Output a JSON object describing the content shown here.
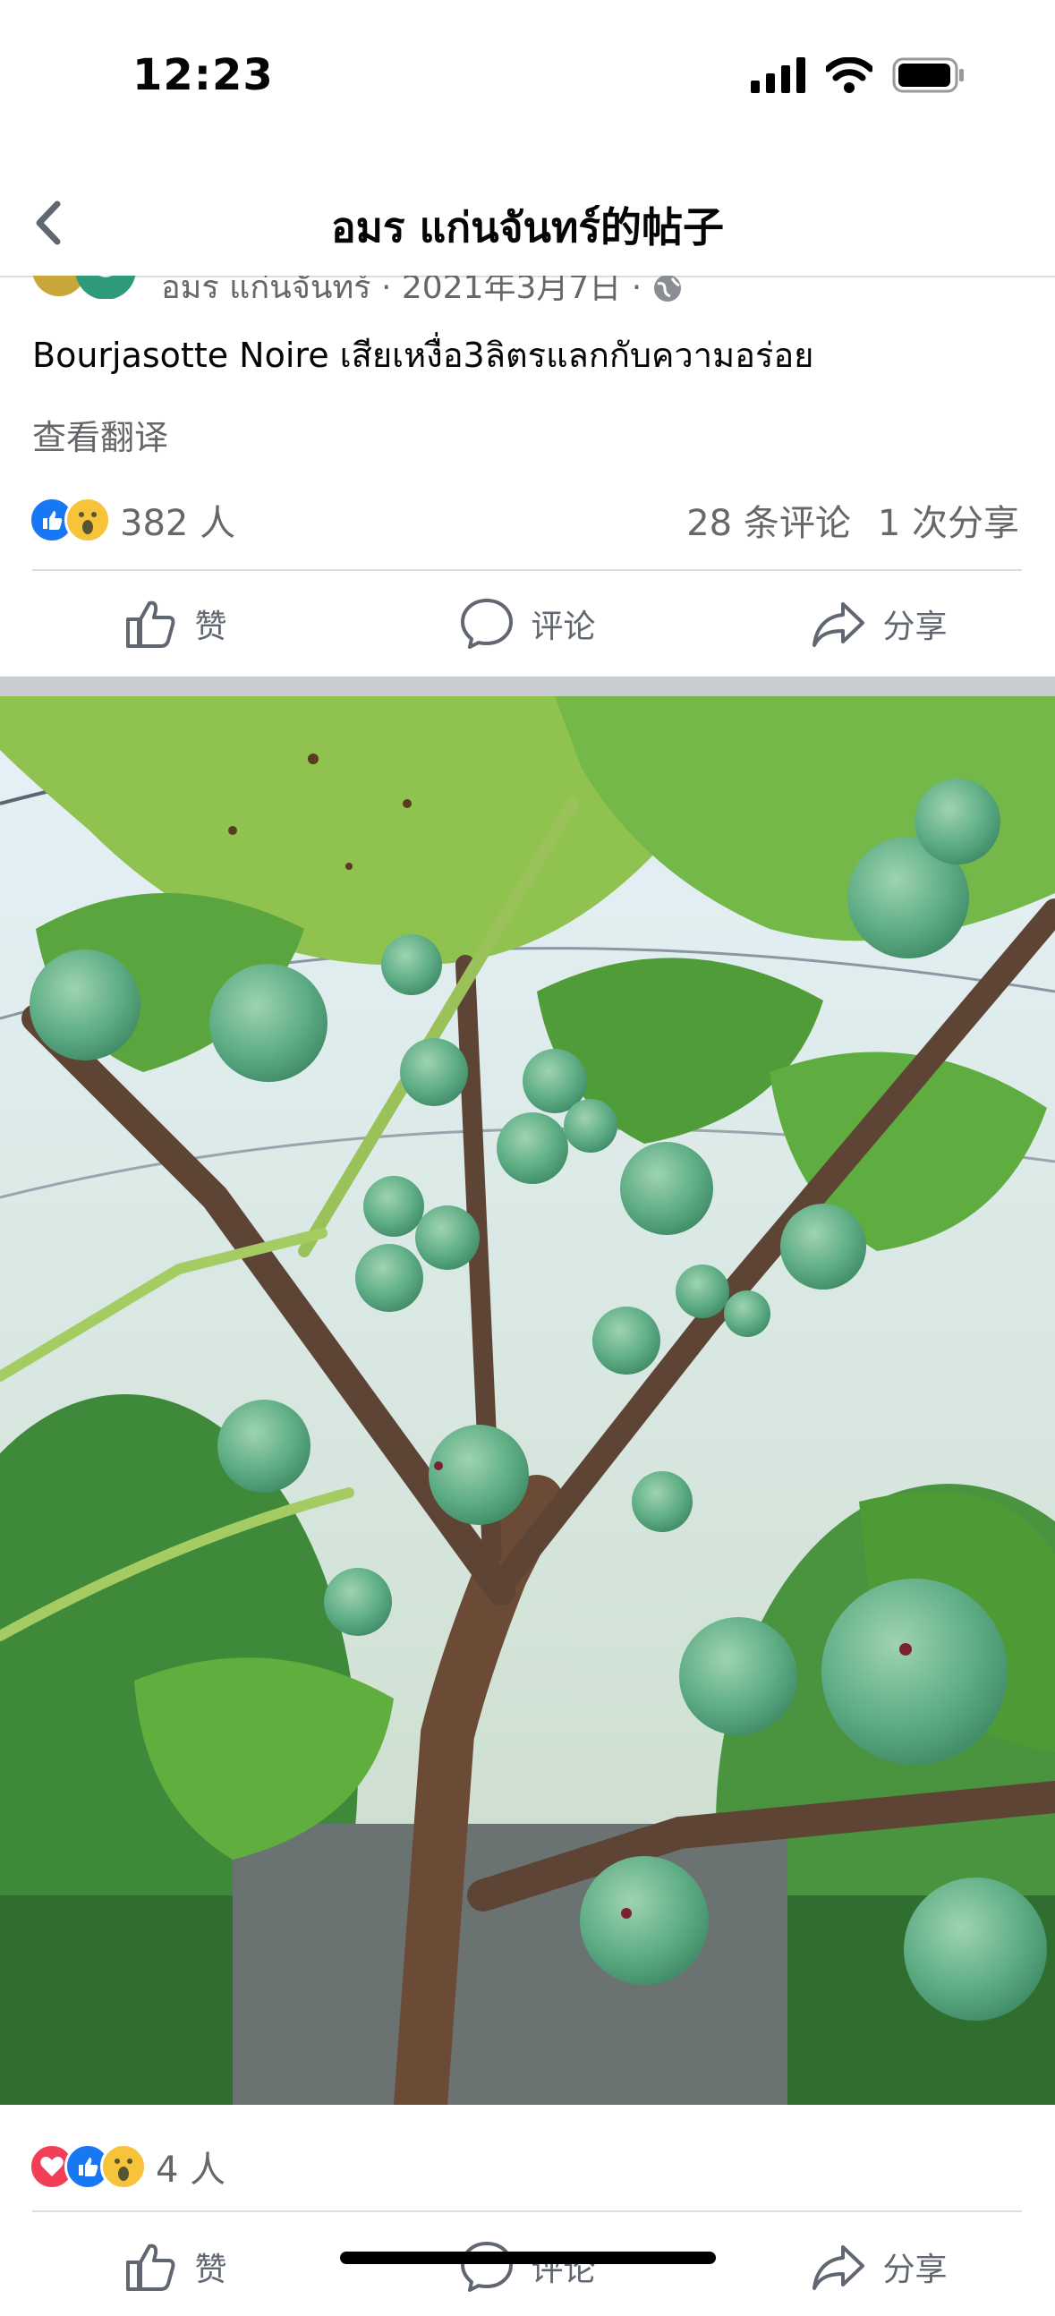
{
  "status_bar": {
    "time": "12:23"
  },
  "nav": {
    "title": "อมร แก่นจันทร์的帖子"
  },
  "post": {
    "author_line": "อมร แก่นจันทร์ · 2021年3月7日 · ",
    "text": "Bourjasotte Noire เสียเหงื่อ3ลิตรแลกกับความอร่อย",
    "translate": "查看翻译",
    "reactions_count": "382 人",
    "comments": "28 条评论",
    "shares": "1 次分享",
    "actions": {
      "like": "赞",
      "comment": "评论",
      "share": "分享"
    }
  },
  "photo_post": {
    "reactions_count": "4 人",
    "actions": {
      "like": "赞",
      "comment": "评论",
      "share": "分享"
    }
  },
  "icons": [
    "back-icon",
    "signal-icon",
    "wifi-icon",
    "battery-icon",
    "globe-icon",
    "like-icon",
    "comment-icon",
    "share-icon"
  ],
  "colors": {
    "like": "#1877f2",
    "love": "#f33e58",
    "wow": "#f7c33b",
    "secondary_text": "#65676b"
  }
}
